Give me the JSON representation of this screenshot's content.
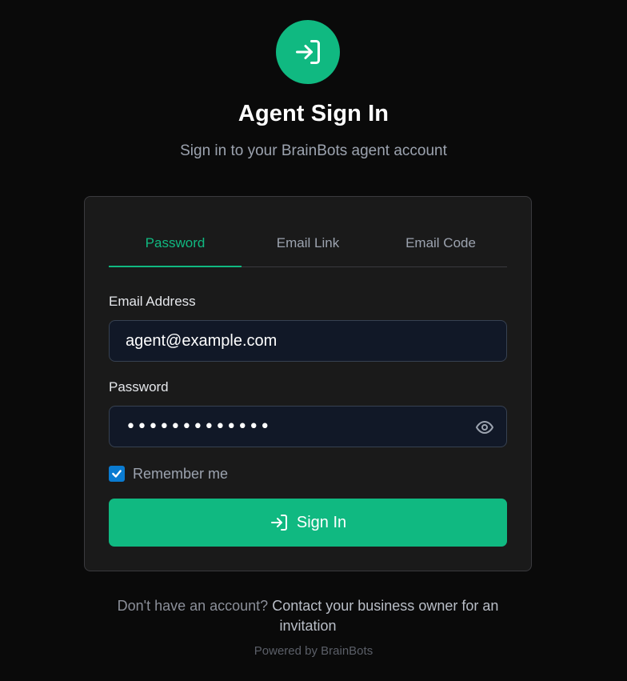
{
  "header": {
    "icon": "sign-in-arrow-icon",
    "title": "Agent Sign In",
    "subtitle": "Sign in to your BrainBots agent account"
  },
  "tabs": [
    {
      "label": "Password",
      "active": true
    },
    {
      "label": "Email Link",
      "active": false
    },
    {
      "label": "Email Code",
      "active": false
    }
  ],
  "form": {
    "email_label": "Email Address",
    "email_value": "agent@example.com",
    "password_label": "Password",
    "password_masked": "•••••••••••••",
    "password_toggle_icon": "eye-icon",
    "remember_label": "Remember me",
    "remember_checked": true,
    "submit_label": "Sign In",
    "submit_icon": "sign-in-arrow-icon"
  },
  "footer": {
    "prompt": "Don't have an account?",
    "link": "Contact your business owner for an invitation",
    "powered_by": "Powered by BrainBots"
  },
  "colors": {
    "accent": "#10b981",
    "background": "#0a0a0a",
    "card": "#1a1a1a",
    "input": "#111827",
    "checkbox": "#0a7bd1"
  }
}
